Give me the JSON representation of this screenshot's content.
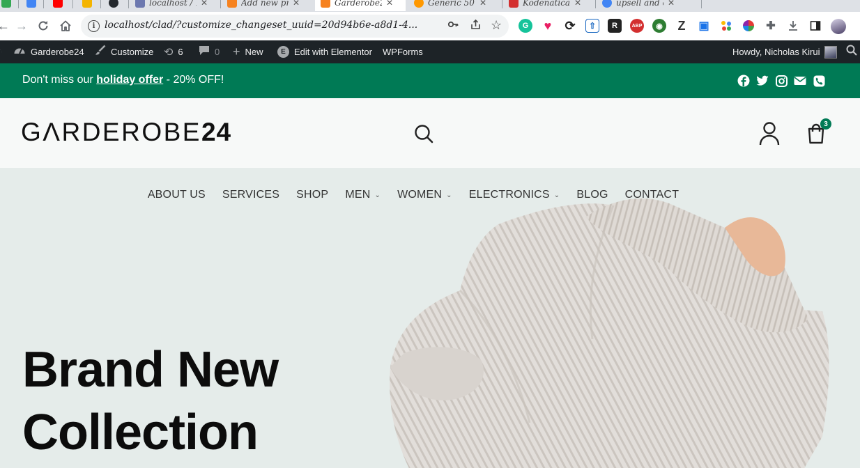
{
  "browser": {
    "tabs": [
      {
        "title": "",
        "favicon_color": "#34a853",
        "active": false
      },
      {
        "title": "",
        "favicon_color": "#4285f4",
        "active": false
      },
      {
        "title": "",
        "favicon_color": "#ff0000",
        "active": false
      },
      {
        "title": "",
        "favicon_color": "#f4b400",
        "active": false
      },
      {
        "title": "",
        "favicon_color": "#24292e",
        "active": false
      },
      {
        "title": "localhost / 1",
        "favicon_color": "#6c78af",
        "active": false
      },
      {
        "title": "Add new pr",
        "favicon_color": "#f6821f",
        "active": false
      },
      {
        "title": "Garderobe2",
        "favicon_color": "#f6821f",
        "active": true
      },
      {
        "title": "Generic 50",
        "favicon_color": "#ff9800",
        "active": false
      },
      {
        "title": "Kodenatica",
        "favicon_color": "#d32f2f",
        "active": false
      },
      {
        "title": "upsell and c",
        "favicon_color": "#4285f4",
        "active": false
      }
    ],
    "url": "localhost/clad/?customize_changeset_uuid=20d94b6e-a8d1-4...",
    "extensions": [
      {
        "name": "grammarly-icon",
        "color": "#15c39a",
        "glyph": "G"
      },
      {
        "name": "heart-extension-icon",
        "color": "#e91e63",
        "glyph": "♥"
      },
      {
        "name": "sync-extension-icon",
        "color": "#222222",
        "glyph": "⟳"
      },
      {
        "name": "upload-extension-icon",
        "color": "#1565c0",
        "glyph": "⇧"
      },
      {
        "name": "r-extension-icon",
        "color": "#222222",
        "glyph": "R"
      },
      {
        "name": "abp-icon",
        "color": "#d32f2f",
        "glyph": "ABP"
      },
      {
        "name": "globe-extension-icon",
        "color": "#2e7d32",
        "glyph": "◉"
      },
      {
        "name": "z-extension-icon",
        "color": "#333333",
        "glyph": "Z"
      },
      {
        "name": "screen-extension-icon",
        "color": "#1a73e8",
        "glyph": "▣"
      },
      {
        "name": "dots-extension-icon",
        "color": "#fbbc04",
        "glyph": "⁘"
      },
      {
        "name": "color-wheel-extension-icon",
        "color": "#9c27b0",
        "glyph": "✿"
      }
    ]
  },
  "adminbar": {
    "site_name": "Garderobe24",
    "customize": "Customize",
    "updates_count": "6",
    "comments_count": "0",
    "new_label": "New",
    "elementor_label": "Edit with Elementor",
    "wpforms_label": "WPForms",
    "howdy": "Howdy, Nicholas Kirui"
  },
  "promo": {
    "prefix": "Don't miss our ",
    "link_text": "holiday offer",
    "suffix": " - 20% OFF!",
    "social": [
      "facebook-icon",
      "twitter-icon",
      "instagram-icon",
      "email-icon",
      "phone-icon"
    ]
  },
  "header": {
    "logo_text": "GΛRDEROBE",
    "logo_number": "24",
    "cart_count": "3"
  },
  "menu": [
    {
      "label": "ABOUT US",
      "has_submenu": false
    },
    {
      "label": "SERVICES",
      "has_submenu": false
    },
    {
      "label": "SHOP",
      "has_submenu": false
    },
    {
      "label": "MEN",
      "has_submenu": true
    },
    {
      "label": "WOMEN",
      "has_submenu": true
    },
    {
      "label": "ELECTRONICS",
      "has_submenu": true
    },
    {
      "label": "BLOG",
      "has_submenu": false
    },
    {
      "label": "CONTACT",
      "has_submenu": false
    }
  ],
  "hero": {
    "headline_line1": "Brand New",
    "headline_line2": "Collection"
  },
  "colors": {
    "brand_green": "#007a55",
    "admin_bar": "#1d2327",
    "hero_bg": "#e5ecea"
  }
}
